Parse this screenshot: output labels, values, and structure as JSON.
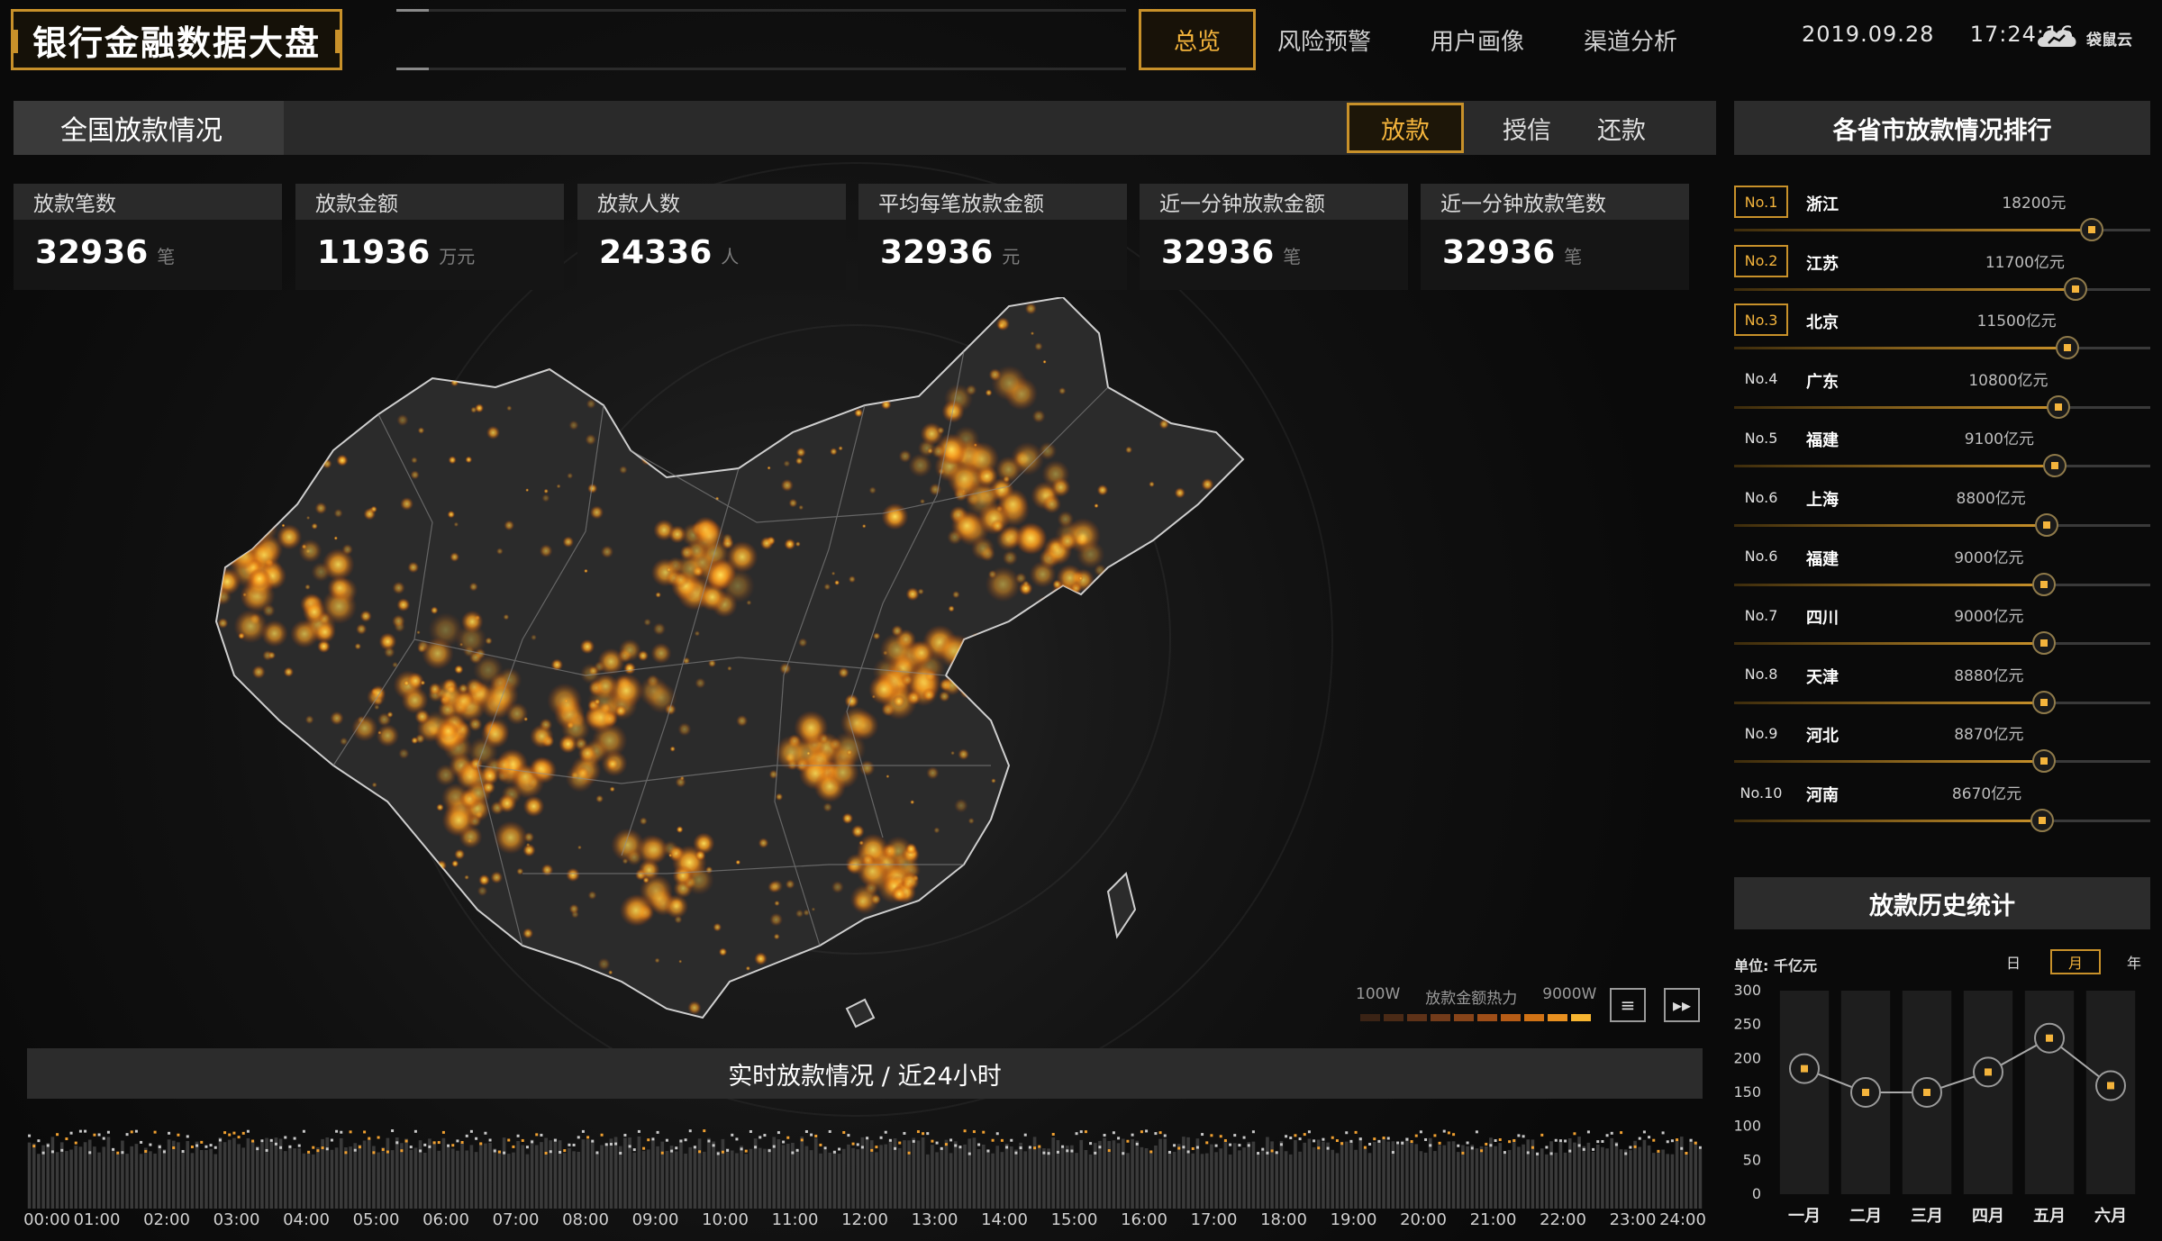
{
  "header": {
    "title": "银行金融数据大盘",
    "nav": [
      "总览",
      "风险预警",
      "用户画像",
      "渠道分析"
    ],
    "active_nav": "总览",
    "date": "2019.09.28",
    "time": "17:24:16",
    "brand": "袋鼠云"
  },
  "national": {
    "title": "全国放款情况",
    "tabs": [
      "放款",
      "授信",
      "还款"
    ],
    "active_tab": "放款",
    "stats": [
      {
        "label": "放款笔数",
        "value": "32936",
        "unit": "笔"
      },
      {
        "label": "放款金额",
        "value": "11936",
        "unit": "万元"
      },
      {
        "label": "放款人数",
        "value": "24336",
        "unit": "人"
      },
      {
        "label": "平均每笔放款金额",
        "value": "32936",
        "unit": "元"
      },
      {
        "label": "近一分钟放款金额",
        "value": "32936",
        "unit": "笔"
      },
      {
        "label": "近一分钟放款笔数",
        "value": "32936",
        "unit": "笔"
      }
    ]
  },
  "map_legend": {
    "min": "100W",
    "label": "放款金额热力",
    "max": "9000W",
    "colors": [
      "#3a2315",
      "#4a2a16",
      "#5e3218",
      "#723b1a",
      "#874419",
      "#9e4e18",
      "#b65c16",
      "#d07215",
      "#e89020",
      "#f7b531"
    ],
    "controls": [
      "list-icon",
      "fast-forward-icon"
    ]
  },
  "realtime": {
    "title": "实时放款情况 / 近24小时",
    "time_labels": [
      "00:00",
      "01:00",
      "02:00",
      "03:00",
      "04:00",
      "05:00",
      "06:00",
      "07:00",
      "08:00",
      "09:00",
      "10:00",
      "11:00",
      "12:00",
      "13:00",
      "14:00",
      "15:00",
      "16:00",
      "17:00",
      "18:00",
      "19:00",
      "20:00",
      "21:00",
      "22:00",
      "23:00",
      "24:00"
    ]
  },
  "ranking": {
    "title": "各省市放款情况排行",
    "items": [
      {
        "no": "No.1",
        "province": "浙江",
        "amount": "18200元",
        "level": 0.86
      },
      {
        "no": "No.2",
        "province": "江苏",
        "amount": "11700亿元",
        "level": 0.82
      },
      {
        "no": "No.3",
        "province": "北京",
        "amount": "11500亿元",
        "level": 0.8
      },
      {
        "no": "No.4",
        "province": "广东",
        "amount": "10800亿元",
        "level": 0.78
      },
      {
        "no": "No.5",
        "province": "福建",
        "amount": "9100亿元",
        "level": 0.77
      },
      {
        "no": "No.6",
        "province": "上海",
        "amount": "8800亿元",
        "level": 0.75
      },
      {
        "no": "No.6",
        "province": "福建",
        "amount": "9000亿元",
        "level": 0.745
      },
      {
        "no": "No.7",
        "province": "四川",
        "amount": "9000亿元",
        "level": 0.745
      },
      {
        "no": "No.8",
        "province": "天津",
        "amount": "8880亿元",
        "level": 0.745
      },
      {
        "no": "No.9",
        "province": "河北",
        "amount": "8870亿元",
        "level": 0.745
      },
      {
        "no": "No.10",
        "province": "河南",
        "amount": "8670亿元",
        "level": 0.74
      }
    ]
  },
  "history": {
    "title": "放款历史统计",
    "unit": "单位: 千亿元",
    "periods": [
      "日",
      "月",
      "年"
    ],
    "active_period": "月"
  },
  "chart_data": {
    "type": "line",
    "categories": [
      "一月",
      "二月",
      "三月",
      "四月",
      "五月",
      "六月"
    ],
    "values": [
      185,
      150,
      150,
      180,
      230,
      160
    ],
    "ylabel": "单位: 千亿元",
    "yticks": [
      0,
      50,
      100,
      150,
      200,
      250,
      300
    ],
    "ylim": [
      0,
      300
    ]
  }
}
